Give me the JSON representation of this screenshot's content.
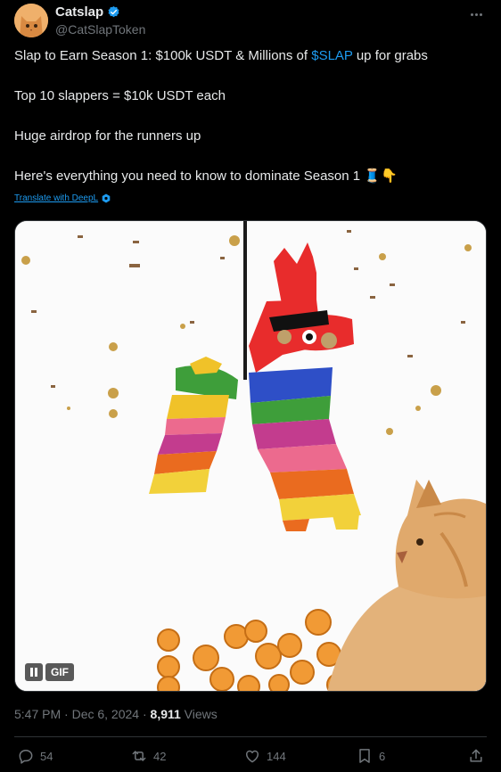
{
  "author": {
    "display_name": "Catslap",
    "handle": "@CatSlapToken"
  },
  "tweet": {
    "line1_prefix": "Slap to Earn Season 1: $100k USDT & Millions of ",
    "line1_cashtag": "$SLAP",
    "line1_suffix": " up for grabs",
    "line2": "Top 10 slappers = $10k USDT each",
    "line3": "Huge airdrop for the runners up",
    "line4": "Here's everything you need to know to dominate Season 1 🧵👇"
  },
  "translate_label": "Translate with DeepL",
  "media": {
    "badge": "GIF"
  },
  "meta": {
    "time": "5:47 PM · Dec 6, 2024 · ",
    "views_count": "8,911",
    "views_label": " Views"
  },
  "actions": {
    "replies": "54",
    "reposts": "42",
    "likes": "144",
    "bookmarks": "6"
  },
  "colors": {
    "accent": "#1d9bf0",
    "background": "#000000",
    "muted": "#71767b",
    "text": "#e7e9ea"
  },
  "icons": [
    "verified-badge-icon",
    "more-icon",
    "pause-icon",
    "reply-icon",
    "repost-icon",
    "like-icon",
    "bookmark-icon",
    "share-icon",
    "deepl-icon"
  ]
}
